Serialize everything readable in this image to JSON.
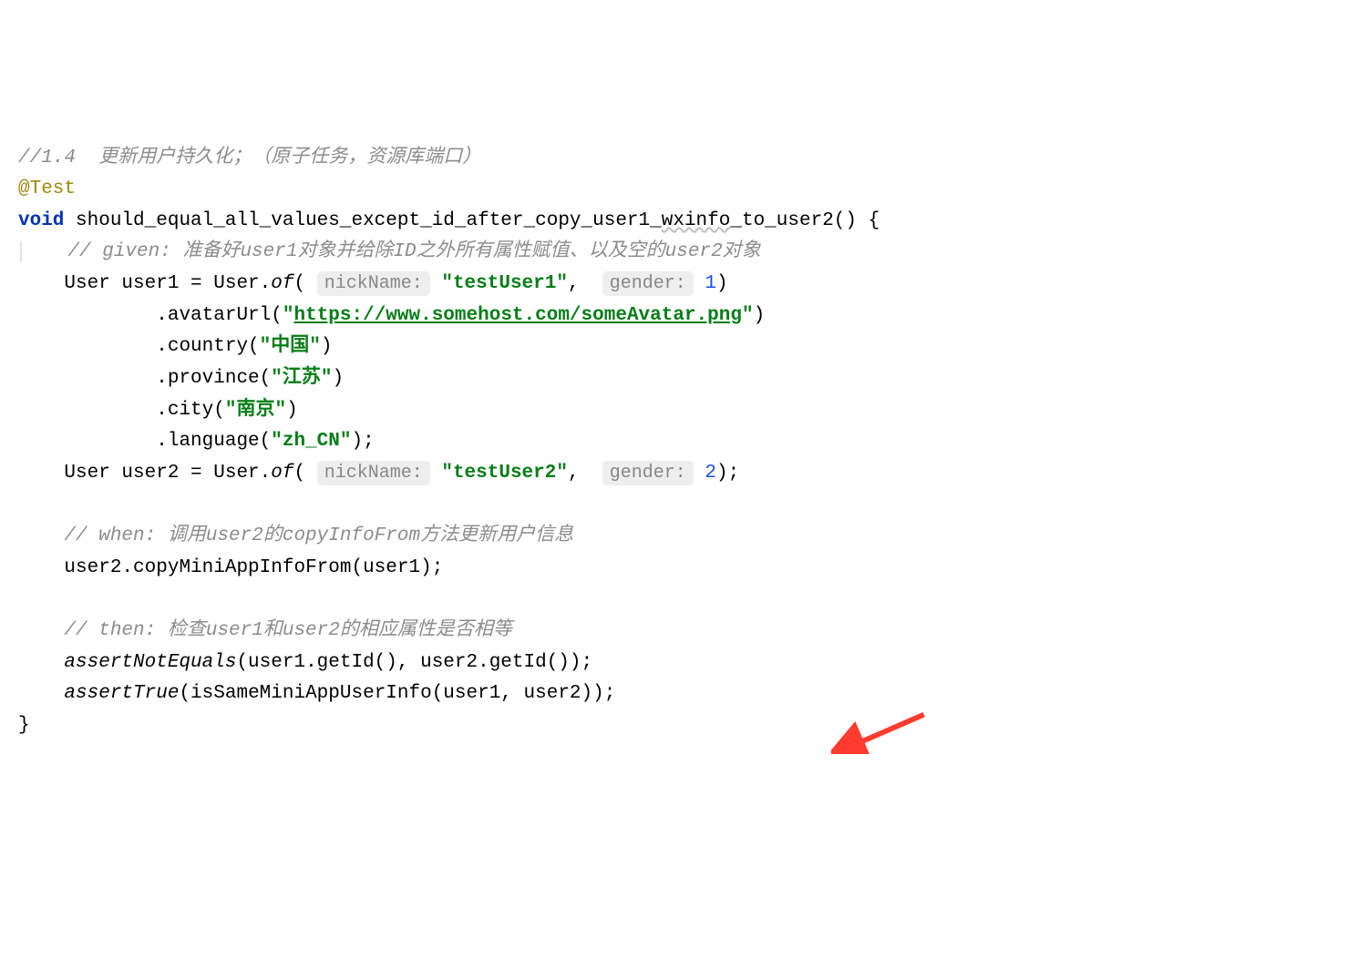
{
  "code": {
    "comment_top": "//1.4  更新用户持久化；（原子任务，资源库端口）",
    "annotation": "@Test",
    "keyword_void": "void",
    "method_name_p1": "should_equal_all_values_except_id_after_copy_user1_",
    "method_name_wavy": "wxinfo",
    "method_name_p2": "_to_user2() {",
    "comment_given": "// given: 准备好user1对象并给除ID之外所有属性赋值、以及空的user2对象",
    "line_user1_a": "User user1 = User.",
    "static_of": "of",
    "open_paren_space": "( ",
    "hint_nickname": "nickName:",
    "space1": " ",
    "str_testuser1": "\"testUser1\"",
    "comma_space": ",  ",
    "hint_gender": "gender:",
    "num_1": "1",
    "close_paren": ")",
    "line_avatar_a": "        .avatarUrl(",
    "str_q": "\"",
    "str_url": "https://www.somehost.com/someAvatar.png",
    "line_country_a": "        .country(",
    "str_china": "\"中国\"",
    "line_province_a": "        .province(",
    "str_jiangsu": "\"江苏\"",
    "line_city_a": "        .city(",
    "str_nanjing": "\"南京\"",
    "line_language_a": "        .language(",
    "str_zhcn": "\"zh_CN\"",
    "close_paren_semi": ");",
    "line_user2_a": "User user2 = User.",
    "str_testuser2": "\"testUser2\"",
    "num_2": "2",
    "comment_when": "// when: 调用user2的copyInfoFrom方法更新用户信息",
    "line_copy": "user2.copyMiniAppInfoFrom(user1);",
    "comment_then": "// then: 检查user1和user2的相应属性是否相等",
    "assert_ne": "assertNotEquals",
    "assert_ne_args": "(user1.getId(), user2.getId());",
    "assert_true": "assertTrue",
    "assert_true_args": "(isSameMiniAppUserInfo(user1, user2));",
    "close_brace": "}"
  },
  "arrow_color": "#ff3b2f"
}
